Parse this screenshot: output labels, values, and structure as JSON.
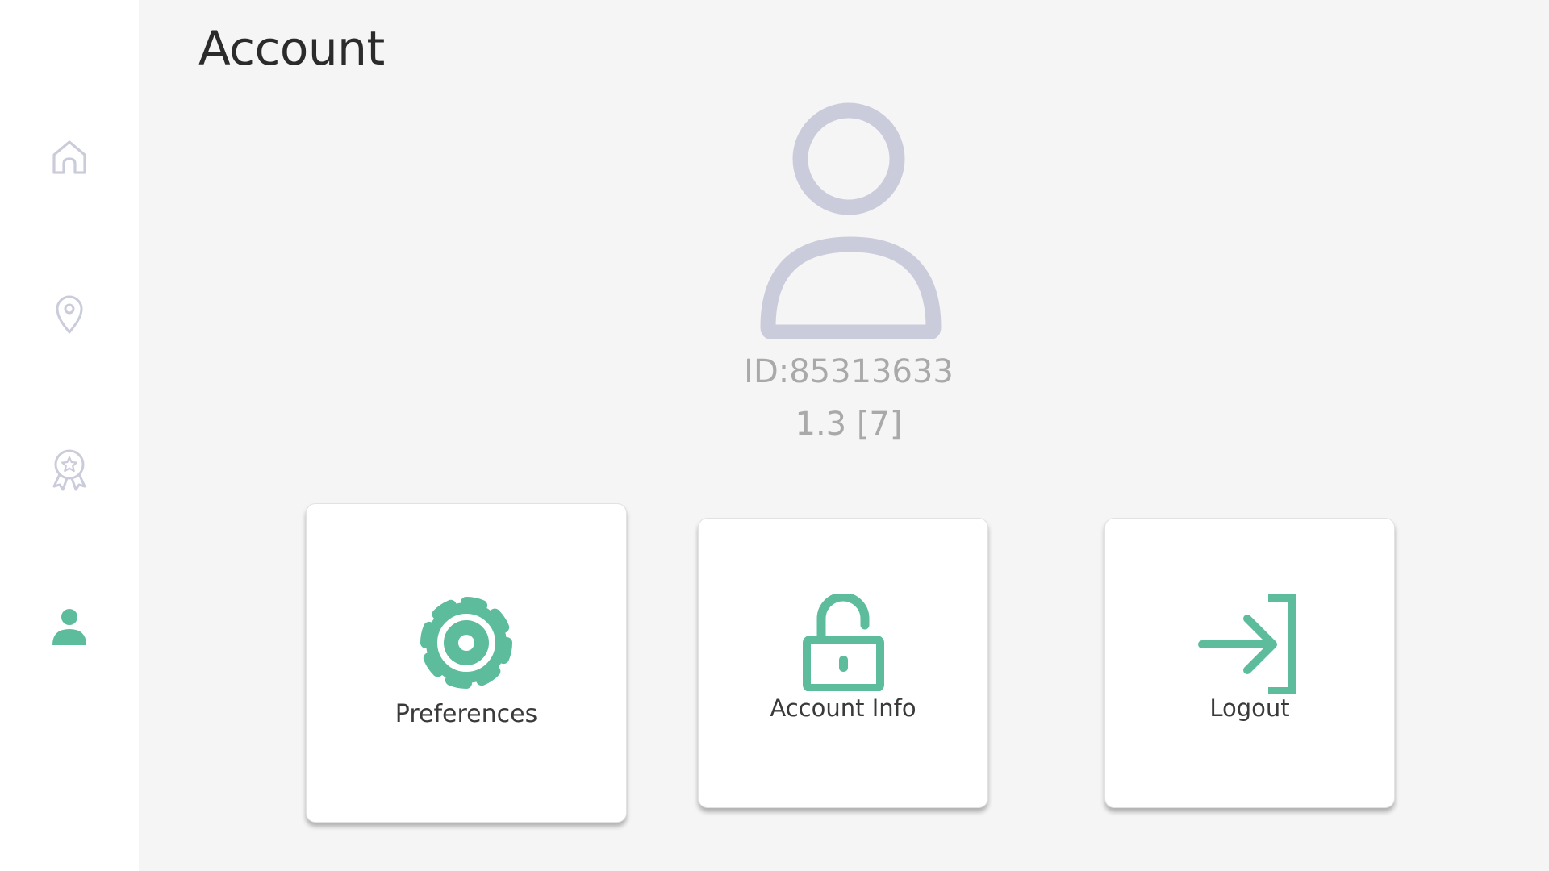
{
  "colors": {
    "accent": "#5cbc9b",
    "inactive_icon": "#cbccdb",
    "muted_text": "#a9a9a9",
    "title_text": "#2b2b2b",
    "background": "#f5f5f5"
  },
  "sidebar": {
    "items": [
      {
        "id": "home",
        "icon": "home-icon",
        "active": false
      },
      {
        "id": "location",
        "icon": "map-pin-icon",
        "active": false
      },
      {
        "id": "rewards",
        "icon": "award-ribbon-icon",
        "active": false
      },
      {
        "id": "account",
        "icon": "user-icon",
        "active": true
      }
    ]
  },
  "header": {
    "title": "Account"
  },
  "profile": {
    "avatar_icon": "user-outline-icon",
    "id_text": "ID:85313633",
    "version_text": "1.3 [7]"
  },
  "actions": [
    {
      "id": "preferences",
      "label": "Preferences",
      "icon": "gear-icon"
    },
    {
      "id": "account_info",
      "label": "Account Info",
      "icon": "unlock-icon"
    },
    {
      "id": "logout",
      "label": "Logout",
      "icon": "logout-arrow-icon"
    }
  ]
}
